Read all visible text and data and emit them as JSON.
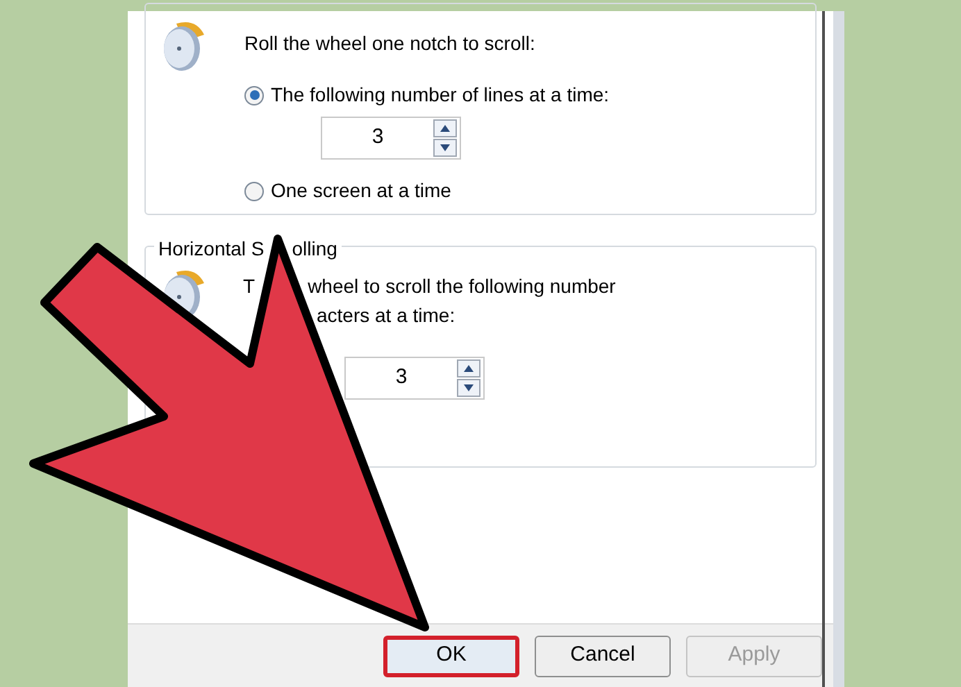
{
  "scroll_group": {
    "prompt": "Roll the wheel one notch to scroll:",
    "options": [
      {
        "label": "The following number of lines at a time:",
        "selected": true
      },
      {
        "label": "One screen at a time",
        "selected": false
      }
    ],
    "lines_value": "3"
  },
  "horizontal_group": {
    "title_parts": [
      "Horizontal S",
      "olling"
    ],
    "line1_parts": [
      "T",
      "wheel to scroll the following number"
    ],
    "line2": "acters at a time:",
    "characters_value": "3"
  },
  "buttons": [
    {
      "label": "OK",
      "focused": true,
      "disabled": false
    },
    {
      "label": "Cancel",
      "focused": false,
      "disabled": false
    },
    {
      "label": "Apply",
      "focused": false,
      "disabled": true
    }
  ]
}
